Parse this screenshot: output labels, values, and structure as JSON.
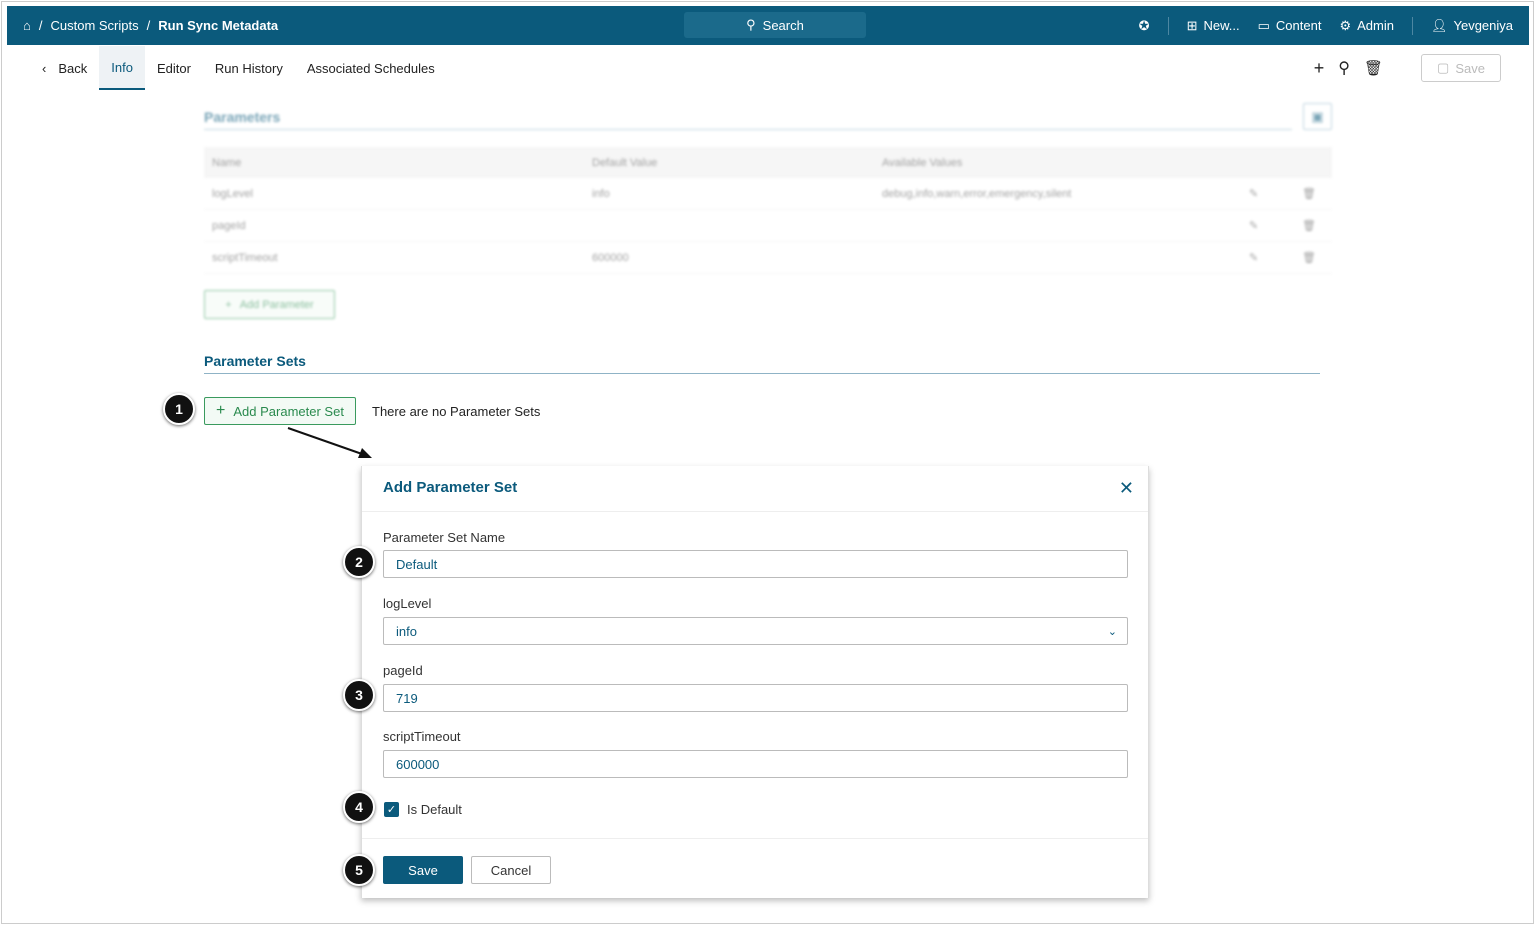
{
  "header": {
    "breadcrumb": [
      "Custom Scripts",
      "Run Sync Metadata"
    ],
    "search": "Search",
    "new": "New...",
    "content": "Content",
    "admin": "Admin",
    "user": "Yevgeniya"
  },
  "tabs": {
    "back": "Back",
    "items": [
      "Info",
      "Editor",
      "Run History",
      "Associated Schedules"
    ],
    "save": "Save"
  },
  "parameters": {
    "title": "Parameters",
    "columns": [
      "Name",
      "Default Value",
      "Available Values"
    ],
    "rows": [
      {
        "name": "logLevel",
        "default": "info",
        "available": "debug,info,warn,error,emergency,silent"
      },
      {
        "name": "pageId",
        "default": "",
        "available": ""
      },
      {
        "name": "scriptTimeout",
        "default": "600000",
        "available": ""
      }
    ],
    "add": "Add Parameter"
  },
  "parameter_sets": {
    "title": "Parameter Sets",
    "add": "Add Parameter Set",
    "empty": "There are no Parameter Sets"
  },
  "modal": {
    "title": "Add Parameter Set",
    "name_label": "Parameter Set Name",
    "name_value": "Default",
    "loglevel_label": "logLevel",
    "loglevel_value": "info",
    "pageid_label": "pageId",
    "pageid_value": "719",
    "timeout_label": "scriptTimeout",
    "timeout_value": "600000",
    "is_default_label": "Is Default",
    "is_default": true,
    "save": "Save",
    "cancel": "Cancel"
  },
  "callouts": [
    "1",
    "2",
    "3",
    "4",
    "5"
  ]
}
